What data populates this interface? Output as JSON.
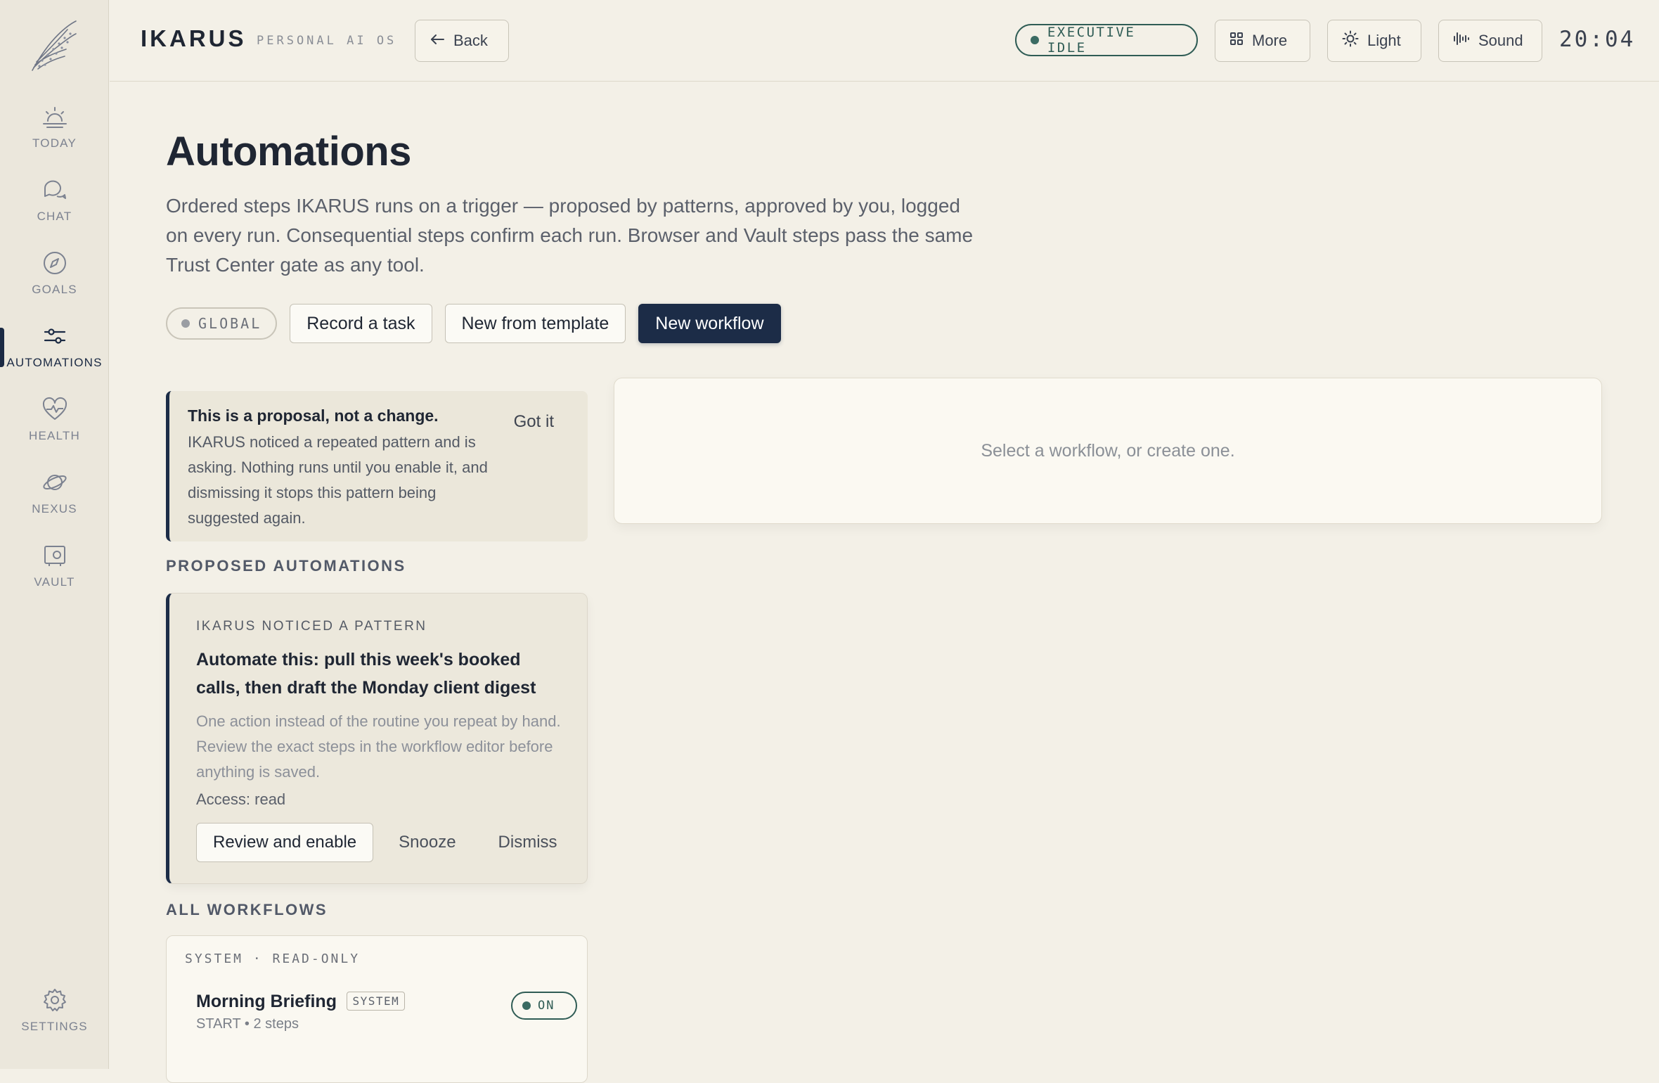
{
  "app": {
    "brand": "IKARUS",
    "subtitle": "PERSONAL AI OS"
  },
  "header": {
    "back_label": "Back",
    "status": "EXECUTIVE IDLE",
    "more_label": "More",
    "theme_label": "Light",
    "sound_label": "Sound",
    "clock": "20:04"
  },
  "sidebar": {
    "items": [
      {
        "label": "TODAY",
        "icon": "sunrise-icon"
      },
      {
        "label": "CHAT",
        "icon": "chat-bubbles-icon"
      },
      {
        "label": "GOALS",
        "icon": "compass-icon"
      },
      {
        "label": "AUTOMATIONS",
        "icon": "sliders-icon",
        "active": true
      },
      {
        "label": "HEALTH",
        "icon": "heart-pulse-icon"
      },
      {
        "label": "NEXUS",
        "icon": "planet-icon"
      },
      {
        "label": "VAULT",
        "icon": "vault-icon"
      }
    ],
    "settings_label": "SETTINGS"
  },
  "page": {
    "title": "Automations",
    "description": "Ordered steps IKARUS runs on a trigger — proposed by patterns, approved by you, logged on every run. Consequential steps confirm each run. Browser and Vault steps pass the same Trust Center gate as any tool.",
    "scope_label": "GLOBAL",
    "record_label": "Record a task",
    "template_label": "New from template",
    "new_workflow_label": "New workflow"
  },
  "notice": {
    "title": "This is a proposal, not a change.",
    "body": "IKARUS noticed a repeated pattern and is asking. Nothing runs until you enable it, and dismissing it stops this pattern being suggested again.",
    "dismiss_label": "Got it"
  },
  "proposed": {
    "heading": "PROPOSED AUTOMATIONS",
    "eyebrow": "IKARUS NOTICED A PATTERN",
    "title": "Automate this: pull this week's booked calls, then draft the Monday client digest",
    "body": "One action instead of the routine you repeat by hand. Review the exact steps in the workflow editor before anything is saved.",
    "access": "Access: read",
    "review_label": "Review and enable",
    "snooze_label": "Snooze",
    "dismiss_label": "Dismiss"
  },
  "workflows": {
    "heading": "ALL WORKFLOWS",
    "group_label": "SYSTEM · READ-ONLY",
    "items": [
      {
        "name": "Morning Briefing",
        "badge": "SYSTEM",
        "meta": "START • 2 steps",
        "state": "ON"
      }
    ]
  },
  "detail": {
    "empty_text": "Select a workflow, or create one."
  },
  "colors": {
    "background": "#f3f0e7",
    "sidebar": "#ebe7dc",
    "accent_navy": "#1c2c47",
    "status_green": "#2f5c55"
  }
}
